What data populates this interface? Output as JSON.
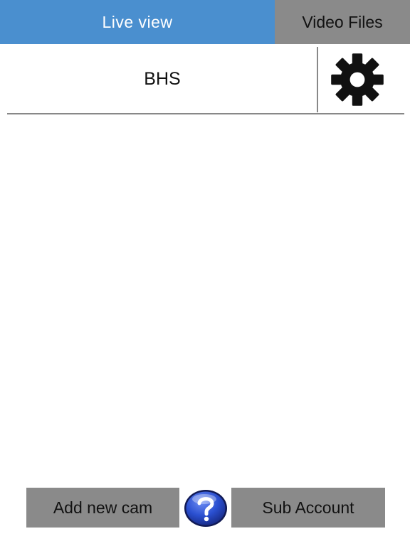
{
  "tabs": {
    "live_view": "Live view",
    "video_files": "Video Files",
    "active": "live_view"
  },
  "cameras": [
    {
      "name": "BHS",
      "settings_icon": "gear-icon"
    }
  ],
  "bottom_bar": {
    "add_cam_label": "Add new cam",
    "help_icon": "question-mark-icon",
    "sub_account_label": "Sub Account"
  },
  "colors": {
    "active_tab": "#4a8fcf",
    "inactive_tab": "#8a8a8a",
    "button": "#8a8a8a",
    "help_blue": "#2a4fd0"
  }
}
